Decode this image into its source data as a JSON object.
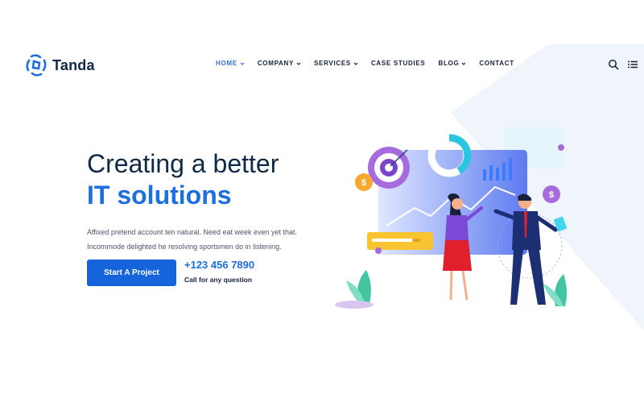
{
  "brand": {
    "name": "Tanda"
  },
  "nav": {
    "items": [
      {
        "label": "HOME",
        "dropdown": true,
        "active": true
      },
      {
        "label": "COMPANY",
        "dropdown": true,
        "active": false
      },
      {
        "label": "SERVICES",
        "dropdown": true,
        "active": false
      },
      {
        "label": "CASE STUDIES",
        "dropdown": false,
        "active": false
      },
      {
        "label": "BLOG",
        "dropdown": true,
        "active": false
      },
      {
        "label": "CONTACT",
        "dropdown": false,
        "active": false
      }
    ],
    "icons": [
      "search-icon",
      "menu-icon"
    ]
  },
  "hero": {
    "title_line1": "Creating a better",
    "title_line2": "IT solutions",
    "description": "Affixed pretend account ten natural. Need eat week even yet that. Incommode delighted he resolving sportsmen do in listening.",
    "cta_label": "Start A Project",
    "phone": "+123 456 7890",
    "phone_caption": "Call for any question"
  },
  "colors": {
    "accent": "#1d6ee0",
    "button": "#1564dc",
    "heading": "#0e2a47",
    "background_shape": "#f0f4fb"
  }
}
